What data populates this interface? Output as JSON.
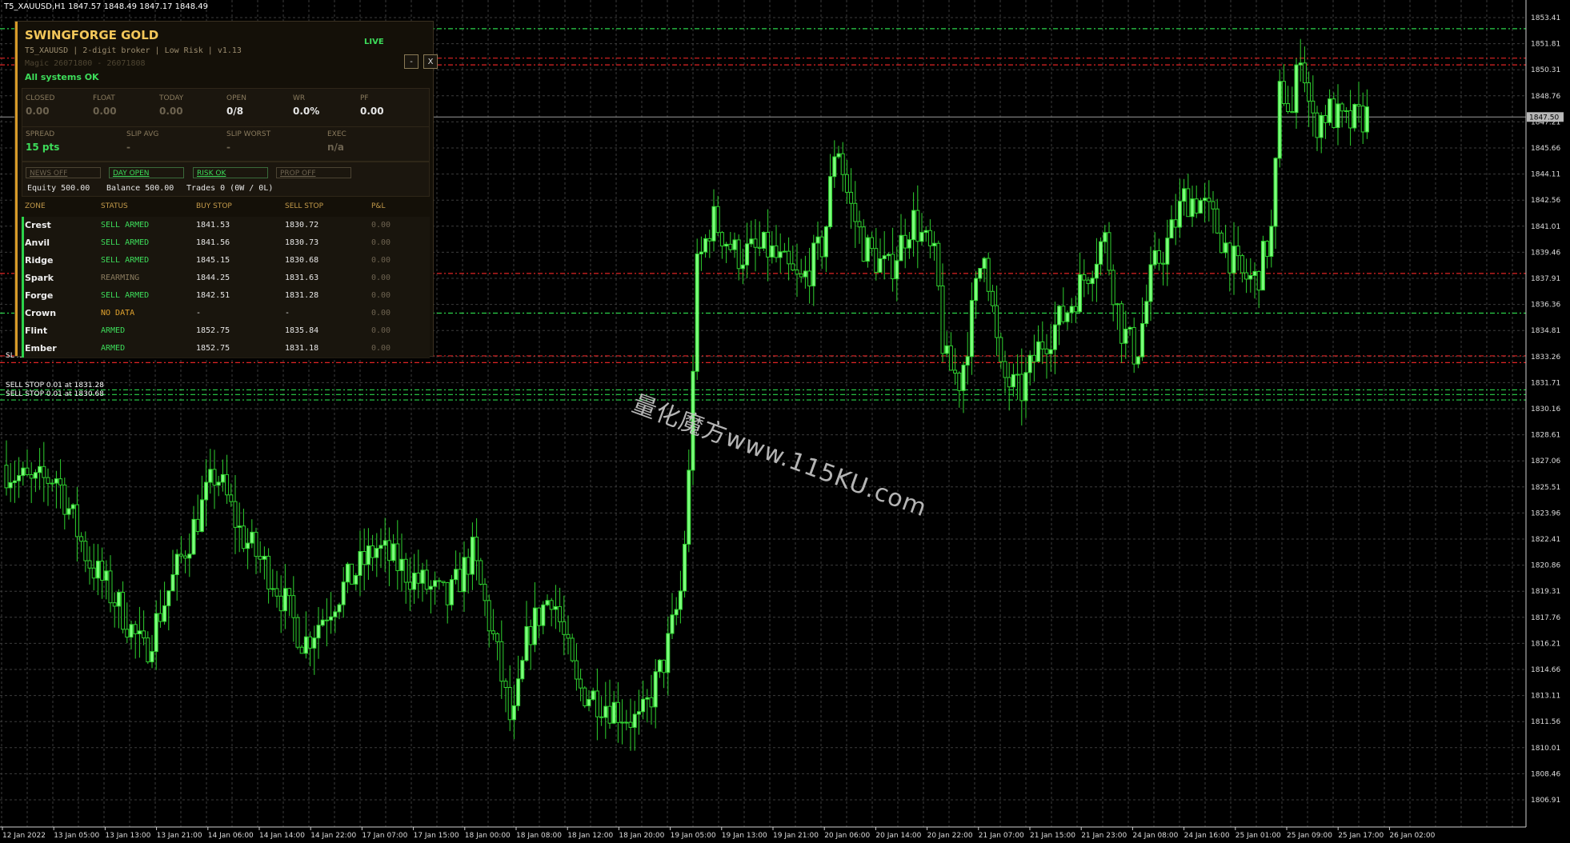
{
  "window": {
    "symbol_info": "T5_XAUUSD,H1  1847.57 1848.49 1847.17 1848.49"
  },
  "watermark": "量化魔方www.115KU.com",
  "price_axis": {
    "labels": [
      "1853.41",
      "1851.81",
      "1850.31",
      "1848.76",
      "1847.21",
      "1845.66",
      "1844.11",
      "1842.56",
      "1841.01",
      "1839.46",
      "1837.91",
      "1836.36",
      "1834.81",
      "1833.26",
      "1831.71",
      "1830.16",
      "1828.61",
      "1827.06",
      "1825.51",
      "1823.96",
      "1822.41",
      "1820.86",
      "1819.31",
      "1817.76",
      "1816.21",
      "1814.66",
      "1813.11",
      "1811.56",
      "1810.01",
      "1808.46",
      "1806.91"
    ],
    "current_price": "1847.50"
  },
  "time_axis": {
    "labels": [
      "12 Jan 2022",
      "13 Jan 05:00",
      "13 Jan 13:00",
      "13 Jan 21:00",
      "14 Jan 06:00",
      "14 Jan 14:00",
      "14 Jan 22:00",
      "17 Jan 07:00",
      "17 Jan 15:00",
      "18 Jan 00:00",
      "18 Jan 08:00",
      "18 Jan 12:00",
      "18 Jan 20:00",
      "19 Jan 05:00",
      "19 Jan 13:00",
      "19 Jan 21:00",
      "20 Jan 06:00",
      "20 Jan 14:00",
      "20 Jan 22:00",
      "21 Jan 07:00",
      "21 Jan 15:00",
      "21 Jan 23:00",
      "24 Jan 08:00",
      "24 Jan 16:00",
      "25 Jan 01:00",
      "25 Jan 09:00",
      "25 Jan 17:00",
      "26 Jan 02:00"
    ]
  },
  "chart_labels": {
    "sl": "SL for",
    "sell_stop_1": "SELL STOP 0.01 at 1831.28",
    "sell_stop_2": "SELL STOP 0.01 at 1830.68"
  },
  "panel": {
    "title": "SWINGFORGE GOLD",
    "status": "LIVE",
    "subtitle": "T5_XAUUSD  |  2-digit broker  |  Low Risk  |  v1.13",
    "magic": "Magic 26071800 - 26071808",
    "minimize": "-",
    "close": "X",
    "system_status": "All systems OK",
    "stats": [
      {
        "caption": "CLOSED",
        "value": "0.00"
      },
      {
        "caption": "FLOAT",
        "value": "0.00"
      },
      {
        "caption": "TODAY",
        "value": "0.00"
      },
      {
        "caption": "OPEN",
        "value": "0/8"
      },
      {
        "caption": "WR",
        "value": "0.0%"
      },
      {
        "caption": "PF",
        "value": "0.00"
      }
    ],
    "exec": [
      {
        "caption": "SPREAD",
        "value": "15 pts"
      },
      {
        "caption": "SLIP AVG",
        "value": "-"
      },
      {
        "caption": "SLIP WORST",
        "value": "-"
      },
      {
        "caption": "EXEC",
        "value": "n/a"
      }
    ],
    "flags": [
      "NEWS OFF",
      "DAY OPEN",
      "RISK OK",
      "PROP OFF"
    ],
    "equity": "Equity 500.00",
    "balance": "Balance 500.00",
    "trades": "Trades 0 (0W / 0L)",
    "table_headers": [
      "ZONE",
      "STATUS",
      "BUY STOP",
      "SELL STOP",
      "P&L"
    ],
    "zones": [
      {
        "zone": "Crest",
        "status": "SELL ARMED",
        "buy": "1841.53",
        "sell": "1830.72",
        "pl": "0.00"
      },
      {
        "zone": "Anvil",
        "status": "SELL ARMED",
        "buy": "1841.56",
        "sell": "1830.73",
        "pl": "0.00"
      },
      {
        "zone": "Ridge",
        "status": "SELL ARMED",
        "buy": "1845.15",
        "sell": "1830.68",
        "pl": "0.00"
      },
      {
        "zone": "Spark",
        "status": "REARMING",
        "buy": "1844.25",
        "sell": "1831.63",
        "pl": "0.00"
      },
      {
        "zone": "Forge",
        "status": "SELL ARMED",
        "buy": "1842.51",
        "sell": "1831.28",
        "pl": "0.00"
      },
      {
        "zone": "Crown",
        "status": "NO DATA",
        "buy": "-",
        "sell": "-",
        "pl": "0.00"
      },
      {
        "zone": "Flint",
        "status": "ARMED",
        "buy": "1852.75",
        "sell": "1835.84",
        "pl": "0.00"
      },
      {
        "zone": "Ember",
        "status": "ARMED",
        "buy": "1852.75",
        "sell": "1831.18",
        "pl": "0.00"
      }
    ]
  },
  "colors": {
    "bull": "#7dff7d",
    "bear": "#000000",
    "wick": "#2fd12f",
    "grid": "#4a4a4a",
    "accent": "#f3c75a",
    "status_green": "#3ddc5a",
    "status_orange": "#e09a30"
  }
}
